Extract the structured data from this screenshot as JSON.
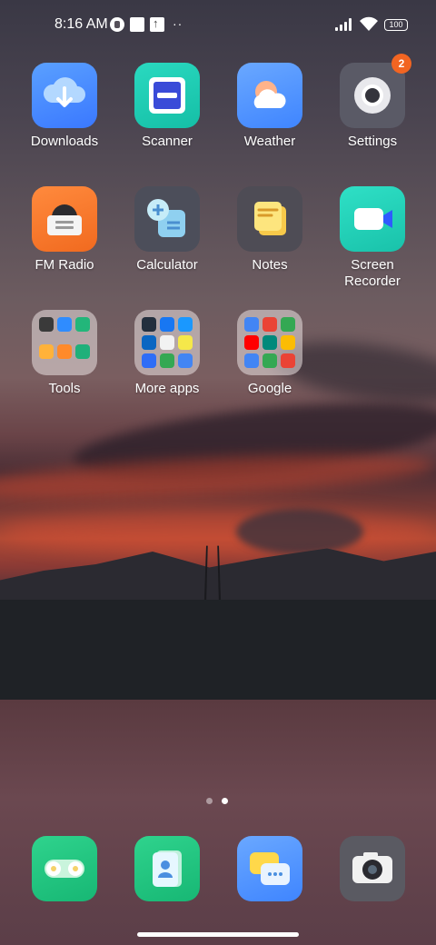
{
  "status_bar": {
    "time": "8:16 AM",
    "battery": "100"
  },
  "apps": [
    {
      "label": "Downloads"
    },
    {
      "label": "Scanner"
    },
    {
      "label": "Weather"
    },
    {
      "label": "Settings",
      "badge": "2"
    },
    {
      "label": "FM Radio"
    },
    {
      "label": "Calculator"
    },
    {
      "label": "Notes"
    },
    {
      "label": "Screen Recorder"
    }
  ],
  "folders": [
    {
      "label": "Tools"
    },
    {
      "label": "More apps"
    },
    {
      "label": "Google"
    }
  ],
  "dock": [
    {
      "icon": "switch-toggle-icon"
    },
    {
      "icon": "contacts-icon"
    },
    {
      "icon": "messaging-icon"
    },
    {
      "icon": "camera-icon"
    }
  ],
  "page_indicator": {
    "pages": 2,
    "current": 2
  },
  "colors": {
    "badge": "#f26522",
    "downloads": "#3a78ff",
    "scanner": "#15bfa6",
    "fm_radio": "#f16a1f",
    "screen_recorder": "#19c2aa"
  }
}
